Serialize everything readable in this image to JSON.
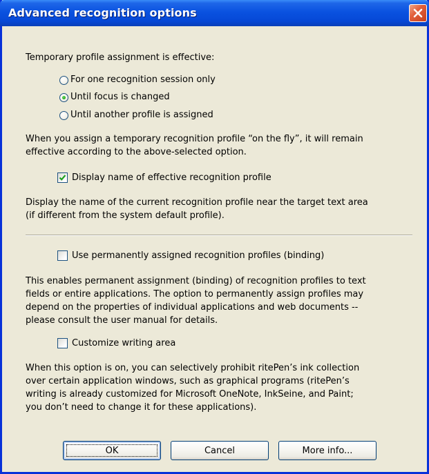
{
  "window": {
    "title": "Advanced recognition options"
  },
  "icons": {
    "close": "close-icon",
    "checkmark": "checkmark-icon"
  },
  "colors": {
    "titlebar": "#0A52E0",
    "close_button": "#E2603C",
    "dialog_background": "#ECE9D8",
    "radio_dot": "#21A121",
    "checkmark": "#21A121"
  },
  "assignment": {
    "heading": "Temporary profile assignment is effective:",
    "options": [
      {
        "label": "For one recognition session only",
        "selected": false
      },
      {
        "label": "Until focus is changed",
        "selected": true
      },
      {
        "label": "Until another profile is assigned",
        "selected": false
      }
    ],
    "description_lines": [
      "When you assign a temporary recognition profile “on the fly”, it will remain",
      "effective according to the above-selected option."
    ]
  },
  "display_name": {
    "label": "Display name of effective recognition profile",
    "checked": true,
    "description_lines": [
      "Display the name of the current recognition profile near the target text area",
      "(if different from the system default profile)."
    ]
  },
  "binding": {
    "label": "Use permanently assigned recognition profiles (binding)",
    "checked": false,
    "description_lines": [
      "This enables permanent assignment (binding) of recognition profiles to text",
      "fields or entire applications. The option to permanently assign profiles may",
      "depend on the properties of individual applications and web documents --",
      "please consult the user manual for details."
    ]
  },
  "writing_area": {
    "label": "Customize writing area",
    "checked": false,
    "description_lines": [
      "When this option is on, you can selectively prohibit ritePen’s ink collection",
      "over certain application windows, such as graphical programs (ritePen’s",
      "writing is already customized for Microsoft OneNote, InkSeine, and Paint;",
      "you don’t need to change it for these applications)."
    ]
  },
  "buttons": {
    "ok": "OK",
    "cancel": "Cancel",
    "more_info": "More info..."
  }
}
